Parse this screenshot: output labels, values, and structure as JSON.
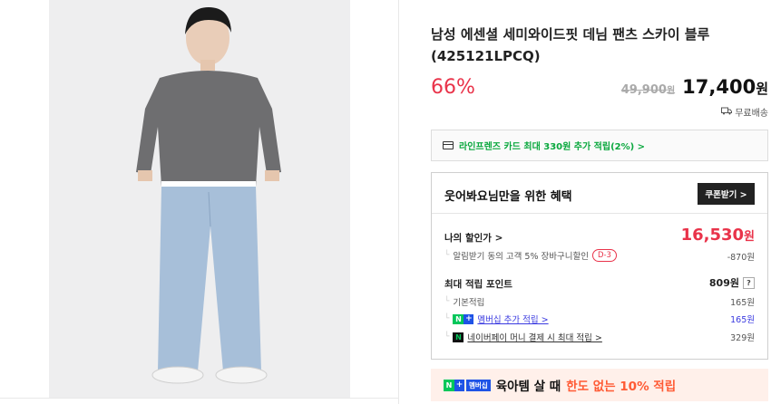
{
  "product": {
    "title": "남성 에센셜 세미와이드핏 데님 팬츠 스카이 블루 (425121LPCQ)",
    "discount_rate": "66%",
    "original_price": "49,900",
    "original_price_unit": "원",
    "sale_price": "17,400",
    "sale_price_unit": "원",
    "shipping": "무료배송"
  },
  "card_promo": {
    "text": "라인프렌즈 카드 최대 330원 추가 적립(2%) >"
  },
  "benefit": {
    "heading": "웃어봐요님만을 위한 혜택",
    "coupon_button": "쿠폰받기 >",
    "my_price_label": "나의 할인가 >",
    "my_price": "16,530",
    "my_price_unit": "원",
    "alarm_discount_label": "알림받기 동의 고객 5% 장바구니할인",
    "alarm_discount_badge": "D-3",
    "alarm_discount_value": "-870원",
    "max_points_label": "최대 적립 포인트",
    "max_points_value": "809원",
    "max_points_help": "?",
    "basic_points_label": "기본적립",
    "basic_points_value": "165원",
    "membership_points_label": "멤버십 추가 적립 >",
    "membership_points_value": "165원",
    "npay_points_label": "네이버페이 머니 결제 시 최대 적립 >",
    "npay_points_value": "329원"
  },
  "banner": {
    "badge_n": "N",
    "badge_plus": "+",
    "badge_membership": "멤버십",
    "text_main": "육아템 살 때",
    "text_accent": "한도 없는 10% 적립"
  },
  "colors": {
    "accent_red": "#e9334a",
    "naver_green": "#03c75a",
    "naver_blue": "#1e53e6"
  }
}
